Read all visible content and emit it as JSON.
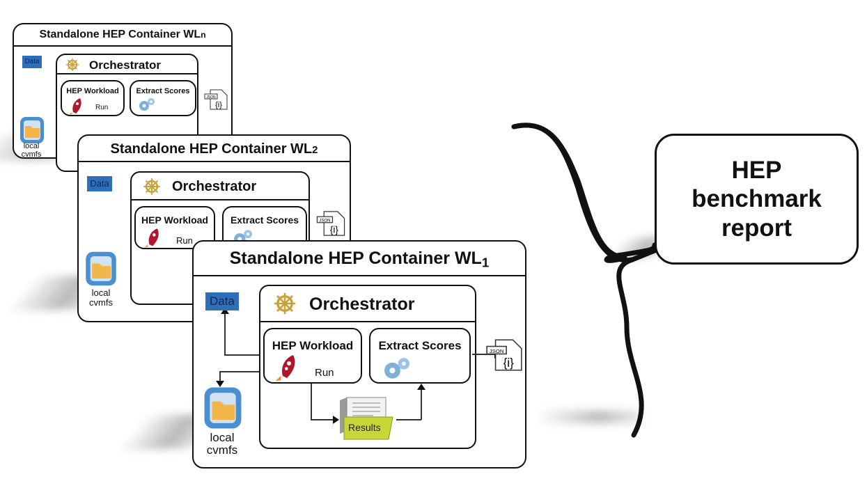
{
  "containers": [
    {
      "id": "wl-n",
      "title": "Standalone HEP Container WL",
      "title_subscript": "n",
      "data_label": "Data",
      "cvmfs_label_line1": "local",
      "cvmfs_label_line2": "cvmfs",
      "orchestrator_label": "Orchestrator",
      "workload_label": "HEP Workload",
      "run_label": "Run",
      "extract_label": "Extract Scores",
      "json_tag": "JSON",
      "json_glyph": "{i}"
    },
    {
      "id": "wl-2",
      "title": "Standalone HEP Container WL",
      "title_subscript": "2",
      "data_label": "Data",
      "cvmfs_label_line1": "local",
      "cvmfs_label_line2": "cvmfs",
      "orchestrator_label": "Orchestrator",
      "workload_label": "HEP Workload",
      "run_label": "Run",
      "extract_label": "Extract Scores",
      "json_tag": "JSON",
      "json_glyph": "{i}"
    },
    {
      "id": "wl-1",
      "title": "Standalone HEP Container WL",
      "title_subscript": "1",
      "data_label": "Data",
      "cvmfs_label_line1": "local",
      "cvmfs_label_line2": "cvmfs",
      "orchestrator_label": "Orchestrator",
      "workload_label": "HEP Workload",
      "run_label": "Run",
      "extract_label": "Extract Scores",
      "results_label": "Results",
      "json_tag": "JSON",
      "json_glyph": "{i}"
    }
  ],
  "report": {
    "line1": "HEP",
    "line2": "benchmark",
    "line3": "report"
  },
  "colors": {
    "data_folder": "#2f6fba",
    "results_folder": "#c9d63a",
    "rocket": "#b0172a",
    "helm": "#c9a13a",
    "gears": "#7fb0d8",
    "cvmfs_frame": "#4a8fd0",
    "cvmfs_folder": "#f3b64a"
  }
}
